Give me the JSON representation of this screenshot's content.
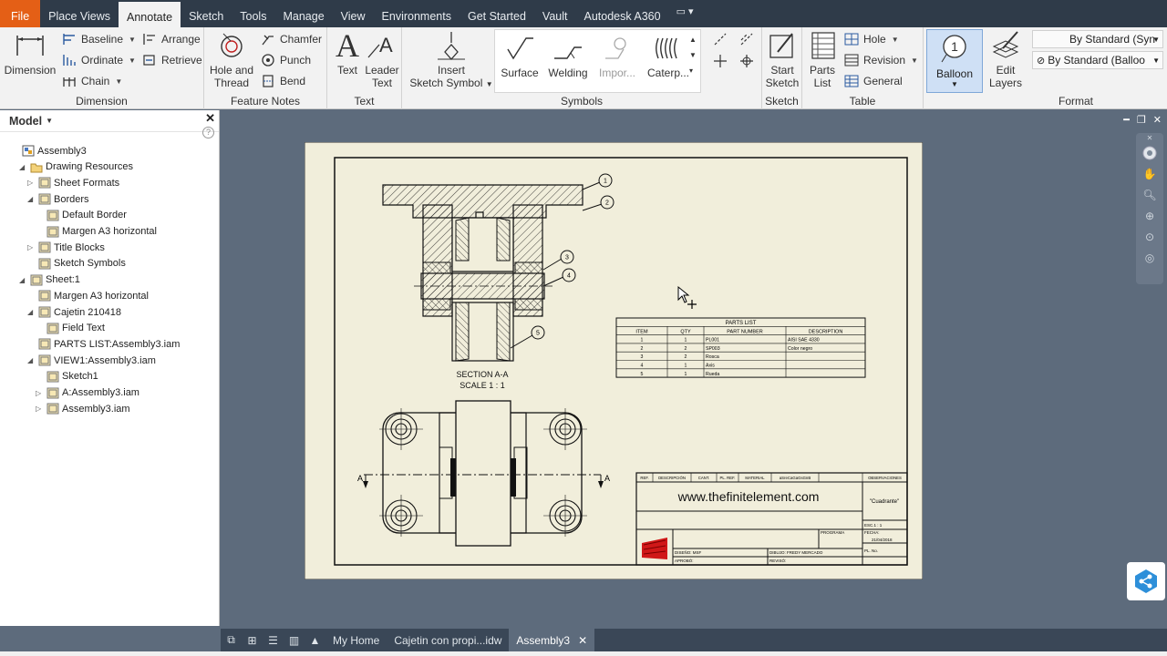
{
  "tabs": [
    "File",
    "Place Views",
    "Annotate",
    "Sketch",
    "Tools",
    "Manage",
    "View",
    "Environments",
    "Get Started",
    "Vault",
    "Autodesk A360"
  ],
  "active_tab": "Annotate",
  "ribbon": {
    "dimension": {
      "title": "Dimension",
      "big": "Dimension",
      "baseline": "Baseline",
      "ordinate": "Ordinate",
      "chain": "Chain",
      "arrange": "Arrange",
      "retrieve": "Retrieve"
    },
    "feature_notes": {
      "title": "Feature Notes",
      "hole_thread_1": "Hole and",
      "hole_thread_2": "Thread",
      "chamfer": "Chamfer",
      "punch": "Punch",
      "bend": "Bend"
    },
    "text": {
      "title": "Text",
      "text": "Text",
      "leader_1": "Leader",
      "leader_2": "Text"
    },
    "symbols": {
      "title": "Symbols",
      "insert_1": "Insert",
      "insert_2": "Sketch Symbol",
      "surface": "Surface",
      "welding": "Welding",
      "import": "Impor...",
      "caterpillar": "Caterp..."
    },
    "sketch": {
      "title": "Sketch",
      "start_1": "Start",
      "start_2": "Sketch"
    },
    "table": {
      "title": "Table",
      "parts_1": "Parts",
      "parts_2": "List",
      "hole": "Hole",
      "revision": "Revision",
      "general": "General"
    },
    "balloon": {
      "label": "Balloon",
      "number": "1"
    },
    "format": {
      "title": "Format",
      "edit_1": "Edit",
      "edit_2": "Layers",
      "style1": "By Standard (Syn",
      "style2": "By Standard (Balloo"
    }
  },
  "browser": {
    "header": "Model",
    "items": [
      {
        "label": "Assembly3",
        "depth": 0,
        "tw": ""
      },
      {
        "label": "Drawing Resources",
        "depth": 1,
        "tw": "◢"
      },
      {
        "label": "Sheet Formats",
        "depth": 2,
        "tw": "▷"
      },
      {
        "label": "Borders",
        "depth": 2,
        "tw": "◢"
      },
      {
        "label": "Default Border",
        "depth": 3,
        "tw": ""
      },
      {
        "label": "Margen A3 horizontal",
        "depth": 3,
        "tw": ""
      },
      {
        "label": "Title Blocks",
        "depth": 2,
        "tw": "▷"
      },
      {
        "label": "Sketch Symbols",
        "depth": 2,
        "tw": ""
      },
      {
        "label": "Sheet:1",
        "depth": 1,
        "tw": "◢"
      },
      {
        "label": "Margen A3 horizontal",
        "depth": 2,
        "tw": ""
      },
      {
        "label": "Cajetin 210418",
        "depth": 2,
        "tw": "◢"
      },
      {
        "label": "Field Text",
        "depth": 3,
        "tw": ""
      },
      {
        "label": "PARTS LIST:Assembly3.iam",
        "depth": 2,
        "tw": ""
      },
      {
        "label": "VIEW1:Assembly3.iam",
        "depth": 2,
        "tw": "◢"
      },
      {
        "label": "Sketch1",
        "depth": 3,
        "tw": ""
      },
      {
        "label": "A:Assembly3.iam",
        "depth": 3,
        "tw": "▷"
      },
      {
        "label": "Assembly3.iam",
        "depth": 3,
        "tw": "▷"
      }
    ]
  },
  "drawing": {
    "section_title": "SECTION A-A",
    "section_scale": "SCALE 1 : 1",
    "section_mark": "A",
    "balloons": [
      "1",
      "2",
      "3",
      "4",
      "5"
    ],
    "parts_list": {
      "title": "PARTS LIST",
      "headers": [
        "ITEM",
        "QTY",
        "PART NUMBER",
        "DESCRIPTION"
      ],
      "rows": [
        [
          "1",
          "1",
          "PL001",
          "AISI SAE 4330"
        ],
        [
          "2",
          "2",
          "SP003",
          "Color negro"
        ],
        [
          "3",
          "2",
          "Rosca",
          ""
        ],
        [
          "4",
          "1",
          "Axis",
          ""
        ],
        [
          "5",
          "1",
          "Rueda",
          ""
        ]
      ]
    },
    "title_block": {
      "headers": [
        "REF.",
        "DESCRIPCIÓN",
        "CANT.",
        "PL. REF.",
        "MATERIAL",
        "aSreCaGaGsGnB",
        "OBSERVACIONES"
      ],
      "website": "www.thefinitelement.com",
      "name": "\"Cuadrante\"",
      "programa": "PROGRAMA",
      "escala": "ESC.1 : 1",
      "fecha_label": "FECHA:",
      "fecha": "21/04/2018",
      "diseno": "DISEÑO: MSF",
      "dibujo": "DIBUJO: FREDY MERCADO",
      "aprobo": "APROBÓ:",
      "reviso": "REVISÓ:",
      "plano": "PL. No."
    }
  },
  "doc_tabs": [
    "My Home",
    "Cajetin con propi...idw",
    "Assembly3"
  ],
  "active_doc": "Assembly3",
  "colors": {
    "file_tab": "#e45f16",
    "tabbar": "#2f3b49",
    "canvas": "#5d6b7c",
    "sheet": "#f1eedb",
    "balloon_active": "#cfe0f5"
  }
}
